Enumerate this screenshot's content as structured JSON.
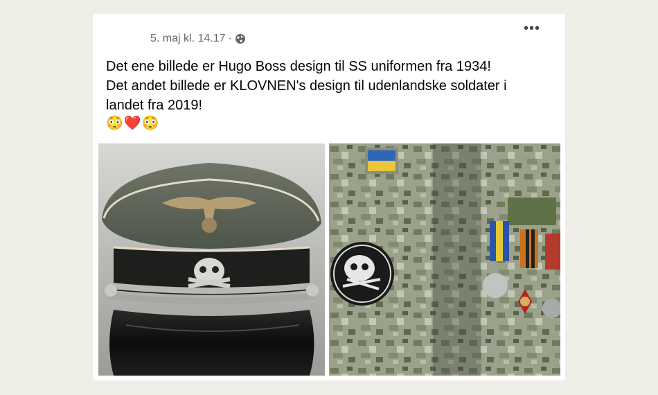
{
  "post": {
    "timestamp": "5. maj kl. 14.17",
    "separator": "·",
    "privacy_icon": "globe-icon",
    "more_icon": "more-options-icon",
    "more_label": "•••",
    "text_lines": [
      "Det ene billede er Hugo Boss design til SS uniformen fra 1934!",
      "Det andet billede er KLOVNEN's design til udenlandske soldater i",
      "landet fra 2019!"
    ],
    "emojis": [
      "😳",
      "❤️",
      "😳"
    ]
  },
  "images": {
    "left": "ss-officer-visor-cap-photo",
    "right": "camouflage-uniform-skull-patch-photo"
  }
}
